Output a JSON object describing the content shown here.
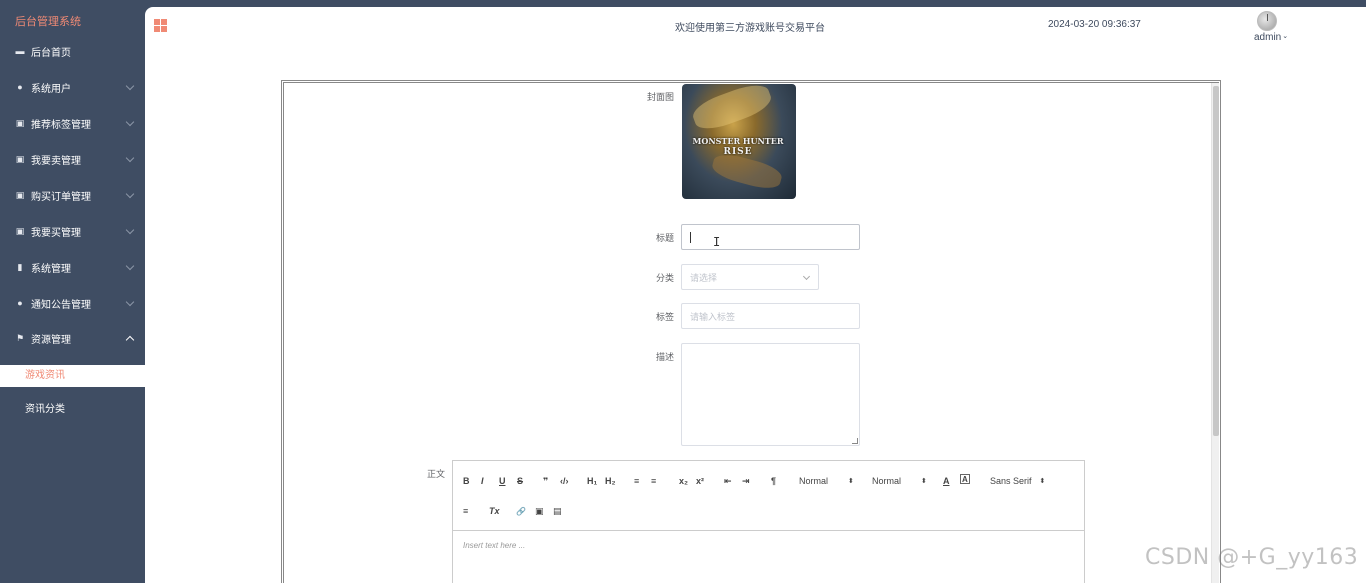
{
  "app": {
    "title": "后台管理系统",
    "welcome": "欢迎使用第三方游戏账号交易平台",
    "datetime": "2024-03-20 09:36:37",
    "user": "admin"
  },
  "colors": {
    "accent": "#f08a75",
    "sidebar_bg": "#3f4d63"
  },
  "sidebar": {
    "items": [
      {
        "label": "后台首页",
        "icon": "monitor-icon"
      },
      {
        "label": "系统用户",
        "icon": "user-icon"
      },
      {
        "label": "推荐标签管理",
        "icon": "edit-icon"
      },
      {
        "label": "我要卖管理",
        "icon": "edit-icon"
      },
      {
        "label": "购买订单管理",
        "icon": "edit-icon"
      },
      {
        "label": "我要买管理",
        "icon": "edit-icon"
      },
      {
        "label": "系统管理",
        "icon": "bar-chart-icon"
      },
      {
        "label": "通知公告管理",
        "icon": "info-icon"
      },
      {
        "label": "资源管理",
        "icon": "flag-icon"
      }
    ],
    "sub_items": [
      {
        "label": "游戏资讯",
        "active": true
      },
      {
        "label": "资讯分类",
        "active": false
      }
    ]
  },
  "form": {
    "cover_label": "封面图",
    "cover_image_text": [
      "MONSTER HUNTER",
      "RISE"
    ],
    "title_label": "标题",
    "title_value": "",
    "category_label": "分类",
    "category_placeholder": "请选择",
    "tags_label": "标签",
    "tags_placeholder": "请输入标签",
    "desc_label": "描述",
    "body_label": "正文"
  },
  "editor": {
    "buttons_row1": [
      "B",
      "I",
      "U",
      "S",
      "❞",
      "‹/›",
      "H₁",
      "H₂",
      "≡",
      "≡",
      "x₂",
      "x²",
      "⇤",
      "⇥",
      "¶"
    ],
    "header_select": "Normal",
    "size_select": "Normal",
    "font_select": "Sans Serif",
    "color_a": "A",
    "bg_a": "A",
    "buttons_row2": [
      "≡",
      "Tx",
      "🔗",
      "▣",
      "▤"
    ],
    "placeholder": "Insert text here ..."
  },
  "watermark": "CSDN @+G_yy163"
}
